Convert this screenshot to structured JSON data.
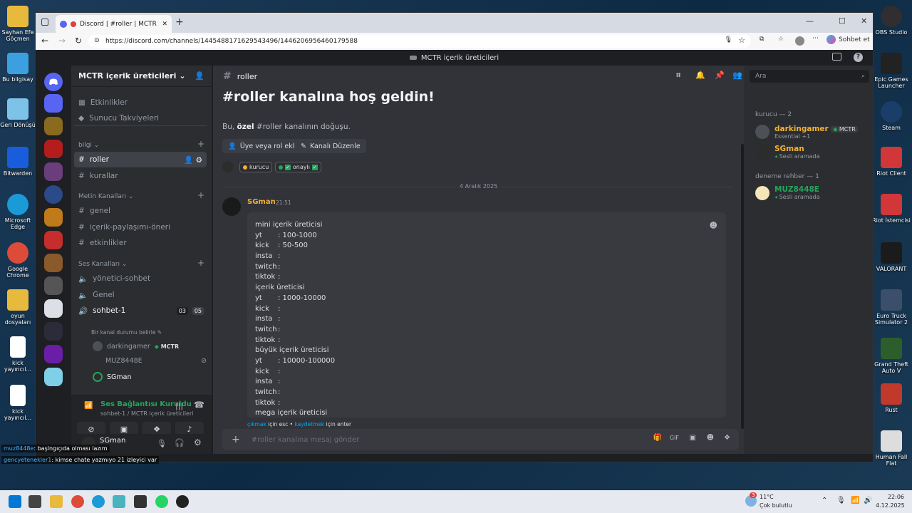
{
  "desktop": {
    "icons": [
      {
        "label": "Sayhan Efe Göçmen",
        "color": "#e7b93d"
      },
      {
        "label": "Bu bilgisay",
        "color": "#3ca0e0"
      },
      {
        "label": "Geri Dönüşü",
        "color": "#7dc3e8"
      },
      {
        "label": "Bitwarden",
        "color": "#175ddc"
      },
      {
        "label": "Microsoft Edge",
        "color": "#1a9ad6"
      },
      {
        "label": "Google Chrome",
        "color": "#dd4b39"
      },
      {
        "label": "oyun dosyaları",
        "color": "#e7b93d"
      },
      {
        "label": "kick yayıncıl...",
        "color": "#ffffff"
      },
      {
        "label": "kick yayıncıl...",
        "color": "#ffffff"
      }
    ],
    "right_icons": [
      {
        "label": "OBS Studio"
      },
      {
        "label": "Epic Games Launcher"
      },
      {
        "label": "Steam"
      },
      {
        "label": "Riot Client"
      },
      {
        "label": "Riot İstemcisi"
      },
      {
        "label": "VALORANT"
      },
      {
        "label": "Euro Truck Simulator 2"
      },
      {
        "label": "Grand Theft Auto V"
      },
      {
        "label": "Rust"
      },
      {
        "label": "Human Fall Flat"
      }
    ]
  },
  "browser": {
    "tab_title": "Discord | #roller | MCTR içe",
    "url": "https://discord.com/channels/1445488171629543496/1446206956460179588",
    "sohbet_label": "Sohbet et"
  },
  "discord": {
    "window_title": "MCTR içerik üreticileri",
    "guild_name": "MCTR içerik üreticileri",
    "top_items": [
      "Etkinlikler",
      "Sunucu Takviyeleri"
    ],
    "categories": {
      "bilgi": "bilgi",
      "metin": "Metin Kanalları",
      "ses": "Ses Kanalları"
    },
    "info_channels": [
      "roller",
      "kurallar"
    ],
    "text_channels": [
      "genel",
      "içerik-paylaşımı-öneri",
      "etkinlikler"
    ],
    "voice_channels": [
      "yönetici-sohbet",
      "Genel",
      "sohbet-1"
    ],
    "voice_status": "Bir kanal durumu belirle",
    "voice_counts": {
      "a": "03",
      "b": "05"
    },
    "voice_users": [
      "darkingamer",
      "MUZ8448E",
      "SGman"
    ],
    "voice_user_tag": "MCTR",
    "connection": {
      "title": "Ses Bağlantısı Kuruldu",
      "sub": "sohbet-1 / MCTR içerik üreticileri"
    },
    "user": {
      "name": "SGman"
    },
    "channel_header": "roller",
    "welcome_title": "#roller kanalına hoş geldin!",
    "welcome_sub_pre": "Bu, ",
    "welcome_sub_bold": "özel",
    "welcome_sub_post": " #roller kanalının doğuşu.",
    "buttons": {
      "add": "Üye veya rol ekle",
      "edit": "Kanalı Düzenle"
    },
    "roles": [
      "kurucu",
      "onaylı"
    ],
    "date_divider": "4 Aralık 2025",
    "message": {
      "author": "SGman",
      "time": "21:51"
    },
    "edit_lines": [
      {
        "k": "",
        "v": "mini içerik üreticisi"
      },
      {
        "k": "yt",
        "v": ": 100-1000"
      },
      {
        "k": "kick",
        "v": ":  50-500"
      },
      {
        "k": "insta",
        "v": ":"
      },
      {
        "k": "twitch",
        "v": ":"
      },
      {
        "k": "tiktok",
        "v": ":"
      },
      {
        "k": "",
        "v": "içerik üreticisi"
      },
      {
        "k": "yt",
        "v": ": 1000-10000"
      },
      {
        "k": "kick",
        "v": ":"
      },
      {
        "k": "insta",
        "v": ":"
      },
      {
        "k": "twitch",
        "v": ":"
      },
      {
        "k": "tiktok",
        "v": ":"
      },
      {
        "k": "",
        "v": "büyük içerik üreticisi"
      },
      {
        "k": "yt",
        "v": ": 10000-100000"
      },
      {
        "k": "kick",
        "v": ":"
      },
      {
        "k": "insta",
        "v": ":"
      },
      {
        "k": "twitch",
        "v": ":"
      },
      {
        "k": "tiktok",
        "v": ":"
      },
      {
        "k": "",
        "v": "mega içerik üreticisi"
      }
    ],
    "edit_hint": {
      "esc_link": "çıkmak",
      "esc_text": " için esc • ",
      "enter_link": "kaydetmek",
      "enter_text": " için enter"
    },
    "composer_placeholder": "#roller kanalına mesaj gönder",
    "search_placeholder": "Ara",
    "member_groups": [
      {
        "title": "kurucu — 2",
        "members": [
          {
            "name": "darkingamer",
            "tag": "MCTR",
            "sub": "Essential +1",
            "color": "#f0b232"
          },
          {
            "name": "SGman",
            "tag": "",
            "sub": "Sesli aramada",
            "color": "#f0b232"
          }
        ]
      },
      {
        "title": "deneme rehber — 1",
        "members": [
          {
            "name": "MUZ8448E",
            "tag": "",
            "sub": "Sesli aramada",
            "color": "#23a55a"
          }
        ]
      }
    ]
  },
  "stream_overlay": [
    {
      "user": "muz8448e",
      "text": ": başlngıçıda olması lazım"
    },
    {
      "user": "gencyetenekler1",
      "text": ": kimse chate yazmıyo 21 izleyici var"
    }
  ],
  "taskbar": {
    "weather_temp": "11°C",
    "weather_desc": "Çok bulutlu",
    "time": "22:06",
    "date": "4.12.2025",
    "badge": "3"
  }
}
